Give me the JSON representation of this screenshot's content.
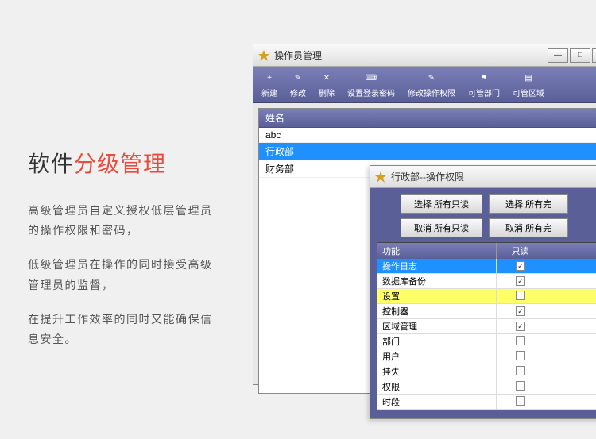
{
  "marketing": {
    "title_black": "软件",
    "title_red": "分级管理",
    "p1": "高级管理员自定义授权低层管理员的操作权限和密码，",
    "p2": "低级管理员在操作的同时接受高级管理员的监督，",
    "p3": "在提升工作效率的同时又能确保信息安全。"
  },
  "main_window": {
    "title": "操作员管理",
    "min": "—",
    "max": "□",
    "close": "✕",
    "toolbar": [
      {
        "icon": "+",
        "label": "新建"
      },
      {
        "icon": "✎",
        "label": "修改"
      },
      {
        "icon": "✕",
        "label": "删除"
      },
      {
        "icon": "⌨",
        "label": "设置登录密码"
      },
      {
        "icon": "✎",
        "label": "修改操作权限"
      },
      {
        "icon": "⚑",
        "label": "可管部门"
      },
      {
        "icon": "▤",
        "label": "可管区域"
      }
    ],
    "list_header": "姓名",
    "rows": [
      {
        "text": "abc",
        "selected": false
      },
      {
        "text": "行政部",
        "selected": true
      },
      {
        "text": "财务部",
        "selected": false
      }
    ]
  },
  "dialog": {
    "title": "行政部--操作权限",
    "buttons_row1": [
      "选择 所有只读",
      "选择 所有完"
    ],
    "buttons_row2": [
      "取消 所有只读",
      "取消 所有完"
    ],
    "header_func": "功能",
    "header_read": "只读",
    "rows": [
      {
        "label": "操作日志",
        "checked": true,
        "hl": "blue"
      },
      {
        "label": "数据库备份",
        "checked": true,
        "hl": ""
      },
      {
        "label": "设置",
        "checked": false,
        "hl": "yellow"
      },
      {
        "label": "控制器",
        "checked": true,
        "hl": ""
      },
      {
        "label": "区域管理",
        "checked": true,
        "hl": ""
      },
      {
        "label": "部门",
        "checked": false,
        "hl": ""
      },
      {
        "label": "用户",
        "checked": false,
        "hl": ""
      },
      {
        "label": "挂失",
        "checked": false,
        "hl": ""
      },
      {
        "label": "权限",
        "checked": false,
        "hl": ""
      },
      {
        "label": "时段",
        "checked": false,
        "hl": ""
      }
    ]
  }
}
